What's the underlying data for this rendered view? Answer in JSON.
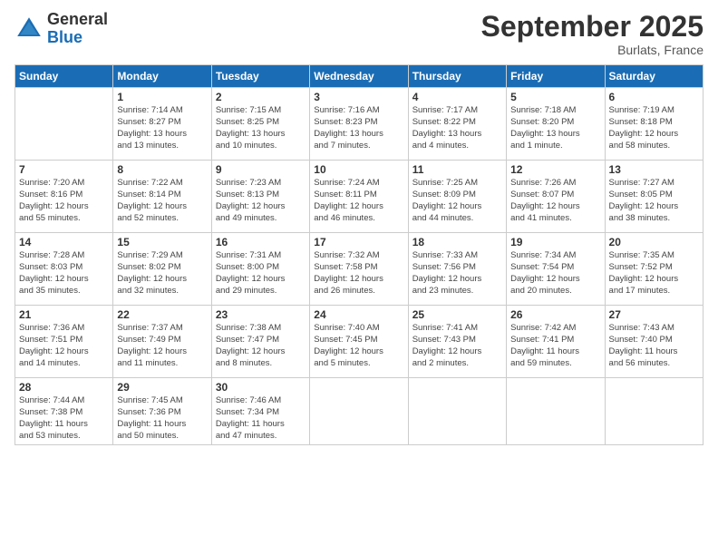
{
  "logo": {
    "general": "General",
    "blue": "Blue"
  },
  "title": "September 2025",
  "location": "Burlats, France",
  "headers": [
    "Sunday",
    "Monday",
    "Tuesday",
    "Wednesday",
    "Thursday",
    "Friday",
    "Saturday"
  ],
  "weeks": [
    [
      {
        "day": "",
        "info": ""
      },
      {
        "day": "1",
        "info": "Sunrise: 7:14 AM\nSunset: 8:27 PM\nDaylight: 13 hours\nand 13 minutes."
      },
      {
        "day": "2",
        "info": "Sunrise: 7:15 AM\nSunset: 8:25 PM\nDaylight: 13 hours\nand 10 minutes."
      },
      {
        "day": "3",
        "info": "Sunrise: 7:16 AM\nSunset: 8:23 PM\nDaylight: 13 hours\nand 7 minutes."
      },
      {
        "day": "4",
        "info": "Sunrise: 7:17 AM\nSunset: 8:22 PM\nDaylight: 13 hours\nand 4 minutes."
      },
      {
        "day": "5",
        "info": "Sunrise: 7:18 AM\nSunset: 8:20 PM\nDaylight: 13 hours\nand 1 minute."
      },
      {
        "day": "6",
        "info": "Sunrise: 7:19 AM\nSunset: 8:18 PM\nDaylight: 12 hours\nand 58 minutes."
      }
    ],
    [
      {
        "day": "7",
        "info": "Sunrise: 7:20 AM\nSunset: 8:16 PM\nDaylight: 12 hours\nand 55 minutes."
      },
      {
        "day": "8",
        "info": "Sunrise: 7:22 AM\nSunset: 8:14 PM\nDaylight: 12 hours\nand 52 minutes."
      },
      {
        "day": "9",
        "info": "Sunrise: 7:23 AM\nSunset: 8:13 PM\nDaylight: 12 hours\nand 49 minutes."
      },
      {
        "day": "10",
        "info": "Sunrise: 7:24 AM\nSunset: 8:11 PM\nDaylight: 12 hours\nand 46 minutes."
      },
      {
        "day": "11",
        "info": "Sunrise: 7:25 AM\nSunset: 8:09 PM\nDaylight: 12 hours\nand 44 minutes."
      },
      {
        "day": "12",
        "info": "Sunrise: 7:26 AM\nSunset: 8:07 PM\nDaylight: 12 hours\nand 41 minutes."
      },
      {
        "day": "13",
        "info": "Sunrise: 7:27 AM\nSunset: 8:05 PM\nDaylight: 12 hours\nand 38 minutes."
      }
    ],
    [
      {
        "day": "14",
        "info": "Sunrise: 7:28 AM\nSunset: 8:03 PM\nDaylight: 12 hours\nand 35 minutes."
      },
      {
        "day": "15",
        "info": "Sunrise: 7:29 AM\nSunset: 8:02 PM\nDaylight: 12 hours\nand 32 minutes."
      },
      {
        "day": "16",
        "info": "Sunrise: 7:31 AM\nSunset: 8:00 PM\nDaylight: 12 hours\nand 29 minutes."
      },
      {
        "day": "17",
        "info": "Sunrise: 7:32 AM\nSunset: 7:58 PM\nDaylight: 12 hours\nand 26 minutes."
      },
      {
        "day": "18",
        "info": "Sunrise: 7:33 AM\nSunset: 7:56 PM\nDaylight: 12 hours\nand 23 minutes."
      },
      {
        "day": "19",
        "info": "Sunrise: 7:34 AM\nSunset: 7:54 PM\nDaylight: 12 hours\nand 20 minutes."
      },
      {
        "day": "20",
        "info": "Sunrise: 7:35 AM\nSunset: 7:52 PM\nDaylight: 12 hours\nand 17 minutes."
      }
    ],
    [
      {
        "day": "21",
        "info": "Sunrise: 7:36 AM\nSunset: 7:51 PM\nDaylight: 12 hours\nand 14 minutes."
      },
      {
        "day": "22",
        "info": "Sunrise: 7:37 AM\nSunset: 7:49 PM\nDaylight: 12 hours\nand 11 minutes."
      },
      {
        "day": "23",
        "info": "Sunrise: 7:38 AM\nSunset: 7:47 PM\nDaylight: 12 hours\nand 8 minutes."
      },
      {
        "day": "24",
        "info": "Sunrise: 7:40 AM\nSunset: 7:45 PM\nDaylight: 12 hours\nand 5 minutes."
      },
      {
        "day": "25",
        "info": "Sunrise: 7:41 AM\nSunset: 7:43 PM\nDaylight: 12 hours\nand 2 minutes."
      },
      {
        "day": "26",
        "info": "Sunrise: 7:42 AM\nSunset: 7:41 PM\nDaylight: 11 hours\nand 59 minutes."
      },
      {
        "day": "27",
        "info": "Sunrise: 7:43 AM\nSunset: 7:40 PM\nDaylight: 11 hours\nand 56 minutes."
      }
    ],
    [
      {
        "day": "28",
        "info": "Sunrise: 7:44 AM\nSunset: 7:38 PM\nDaylight: 11 hours\nand 53 minutes."
      },
      {
        "day": "29",
        "info": "Sunrise: 7:45 AM\nSunset: 7:36 PM\nDaylight: 11 hours\nand 50 minutes."
      },
      {
        "day": "30",
        "info": "Sunrise: 7:46 AM\nSunset: 7:34 PM\nDaylight: 11 hours\nand 47 minutes."
      },
      {
        "day": "",
        "info": ""
      },
      {
        "day": "",
        "info": ""
      },
      {
        "day": "",
        "info": ""
      },
      {
        "day": "",
        "info": ""
      }
    ]
  ]
}
